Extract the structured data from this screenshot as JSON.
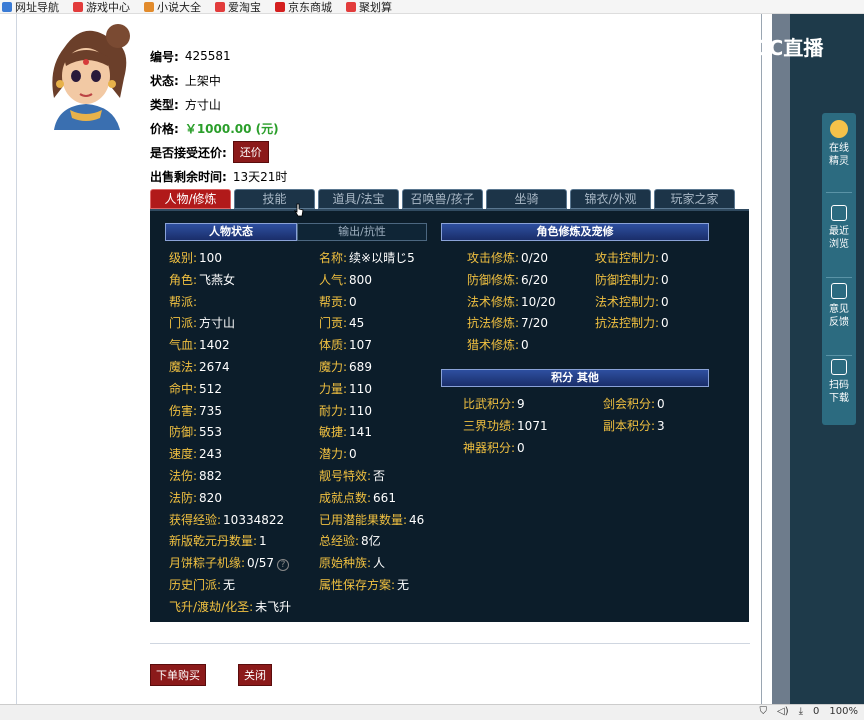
{
  "bookmarks": [
    {
      "label": "网址导航",
      "color": "#3a7bd5"
    },
    {
      "label": "游戏中心",
      "color": "#e23c3c"
    },
    {
      "label": "小说大全",
      "color": "#e28b2c"
    },
    {
      "label": "爱淘宝",
      "color": "#e23c3c"
    },
    {
      "label": "京东商城",
      "color": "#d41f1f"
    },
    {
      "label": "聚划算",
      "color": "#e23c3c"
    }
  ],
  "item": {
    "number_label": "编号:",
    "number": "425581",
    "status_label": "状态:",
    "status": "上架中",
    "type_label": "类型:",
    "type": "方寸山",
    "price_label": "价格:",
    "price": "￥1000.00 (元)",
    "bargain_label": "是否接受还价:",
    "bargain_button": "还价",
    "remaining_label": "出售剩余时间:",
    "remaining": "13天21时"
  },
  "tabs": [
    {
      "label": "人物/修炼",
      "active": true
    },
    {
      "label": "技能",
      "active": false
    },
    {
      "label": "道具/法宝",
      "active": false
    },
    {
      "label": "召唤兽/孩子",
      "active": false
    },
    {
      "label": "坐骑",
      "active": false
    },
    {
      "label": "锦衣/外观",
      "active": false
    },
    {
      "label": "玩家之家",
      "active": false
    }
  ],
  "sections": {
    "char_status": "人物状态",
    "output_resist": "输出/抗性",
    "cultivation": "角色修炼及宠修",
    "points_other": "积分 其他"
  },
  "attrs_left": [
    {
      "label": "级别:",
      "value": "100"
    },
    {
      "label": "角色:",
      "value": "飞燕女"
    },
    {
      "label": "帮派:",
      "value": ""
    },
    {
      "label": "门派:",
      "value": "方寸山"
    },
    {
      "label": "气血:",
      "value": "1402"
    },
    {
      "label": "魔法:",
      "value": "2674"
    },
    {
      "label": "命中:",
      "value": "512"
    },
    {
      "label": "伤害:",
      "value": "735"
    },
    {
      "label": "防御:",
      "value": "553"
    },
    {
      "label": "速度:",
      "value": "243"
    },
    {
      "label": "法伤:",
      "value": "882"
    },
    {
      "label": "法防:",
      "value": "820"
    },
    {
      "label": "获得经验:",
      "value": "10334822"
    },
    {
      "label": "新版乾元丹数量:",
      "value": "1"
    },
    {
      "label": "月饼粽子机缘:",
      "value": "0/57"
    },
    {
      "label": "历史门派:",
      "value": "无"
    },
    {
      "label": "飞升/渡劫/化圣:",
      "value": "未飞升"
    }
  ],
  "attrs_mid": [
    {
      "label": "名称:",
      "value": "续※以晴じ5"
    },
    {
      "label": "人气:",
      "value": "800"
    },
    {
      "label": "帮贡:",
      "value": "0"
    },
    {
      "label": "门贡:",
      "value": "45"
    },
    {
      "label": "体质:",
      "value": "107"
    },
    {
      "label": "魔力:",
      "value": "689"
    },
    {
      "label": "力量:",
      "value": "110"
    },
    {
      "label": "耐力:",
      "value": "110"
    },
    {
      "label": "敏捷:",
      "value": "141"
    },
    {
      "label": "潜力:",
      "value": "0"
    },
    {
      "label": "靓号特效:",
      "value": "否"
    },
    {
      "label": "成就点数:",
      "value": "661"
    },
    {
      "label": "已用潜能果数量:",
      "value": "46"
    },
    {
      "label": "总经验:",
      "value": "8亿"
    },
    {
      "label": "原始种族:",
      "value": "人"
    },
    {
      "label": "属性保存方案:",
      "value": "无"
    }
  ],
  "cultivation_left": [
    {
      "label": "攻击修炼:",
      "value": "0/20"
    },
    {
      "label": "防御修炼:",
      "value": "6/20"
    },
    {
      "label": "法术修炼:",
      "value": "10/20"
    },
    {
      "label": "抗法修炼:",
      "value": "7/20"
    },
    {
      "label": "猎术修炼:",
      "value": "0"
    }
  ],
  "cultivation_right": [
    {
      "label": "攻击控制力:",
      "value": "0"
    },
    {
      "label": "防御控制力:",
      "value": "0"
    },
    {
      "label": "法术控制力:",
      "value": "0"
    },
    {
      "label": "抗法控制力:",
      "value": "0"
    }
  ],
  "points_left": [
    {
      "label": "比武积分:",
      "value": "9"
    },
    {
      "label": "三界功绩:",
      "value": "1071"
    },
    {
      "label": "神器积分:",
      "value": "0"
    }
  ],
  "points_right": [
    {
      "label": "剑会积分:",
      "value": "0"
    },
    {
      "label": "副本积分:",
      "value": "3"
    }
  ],
  "bottom": {
    "buy": "下单购买",
    "close": "关闭"
  },
  "cc": {
    "logo_text": "CC直播"
  },
  "side": [
    {
      "label": "在线精灵",
      "icon": "fairy-avatar-icon"
    },
    {
      "label": "最近浏览",
      "icon": "clock-icon"
    },
    {
      "label": "意见反馈",
      "icon": "edit-icon"
    },
    {
      "label": "扫码下载",
      "icon": "qr-scan-icon"
    }
  ],
  "status_bar": {
    "zoom": "100%",
    "count": "0"
  }
}
